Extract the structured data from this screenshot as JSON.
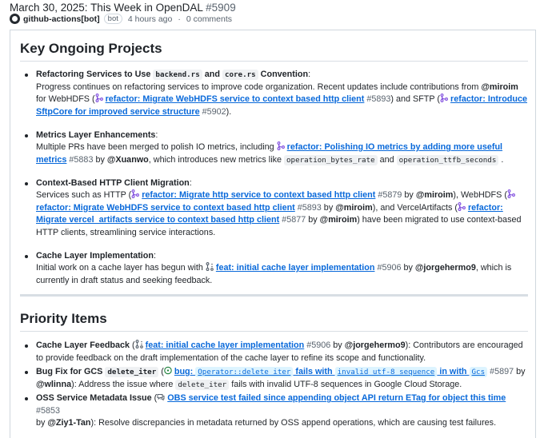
{
  "discussion": {
    "title": "March 30, 2025: This Week in OpenDAL",
    "number": "#5909",
    "author": "github-actions[bot]",
    "bot_badge": "bot",
    "time": "4 hours ago",
    "separator": "·",
    "comments": "0 comments"
  },
  "sections": {
    "key_title": "Key Ongoing Projects",
    "priority_title": "Priority Items"
  },
  "key": {
    "refactor": {
      "h1": "Refactoring Services to Use ",
      "code1": "backend.rs",
      "and": " and ",
      "code2": "core.rs",
      "h2": " Convention",
      "colon": ":",
      "t1": "Progress continues on refactoring services to improve code organization. Recent updates include contributions from ",
      "m1": "@miroim",
      "t2": " for WebHDFS (",
      "pr1": "refactor: Migrate WebHDFS service to context based http client",
      "n1": "#5893",
      "t3": ") and SFTP (",
      "pr2": "refactor: Introduce SftpCore for improved service structure",
      "n2": "#5902",
      "t4": ")."
    },
    "metrics": {
      "h": "Metrics Layer Enhancements",
      "colon": ":",
      "t1": "Multiple PRs have been merged to polish IO metrics, including ",
      "pr1": "refactor: Polishing IO metrics by adding more useful metrics",
      "n1": "#5883",
      "by": " by ",
      "m1": "@Xuanwo",
      "t2": ", which introduces new metrics like ",
      "c1": "operation_bytes_rate",
      "and": " and ",
      "c2": "operation_ttfb_seconds",
      "t3": " ."
    },
    "http": {
      "h": "Context-Based HTTP Client Migration",
      "colon": ":",
      "t1": "Services such as HTTP (",
      "pr1": "refactor: Migrate http service to context based http client",
      "n1": "#5879",
      "by1": " by ",
      "m1": "@miroim",
      "t2": "), WebHDFS (",
      "pr2": "refactor: Migrate WebHDFS service to context based http client",
      "n2": "#5893",
      "by2": " by ",
      "m2": "@miroim",
      "t3": "), and VercelArtifacts (",
      "pr3": "refactor: Migrate vercel_artifacts service to context based http client",
      "n3": "#5877",
      "by3": " by ",
      "m3": "@miroim",
      "t4": ") have been migrated to use context-based HTTP clients, streamlining service interactions."
    },
    "cache": {
      "h": "Cache Layer Implementation",
      "colon": ":",
      "t1": "Initial work on a cache layer has begun with ",
      "pr1": "feat: initial cache layer implementation",
      "n1": "#5906",
      "by": " by ",
      "m1": "@jorgehermo9",
      "t2": ", which is currently in draft status and seeking feedback."
    }
  },
  "priority": {
    "cache": {
      "h": "Cache Layer Feedback",
      "t1": " (",
      "pr1": "feat: initial cache layer implementation",
      "n1": "#5906",
      "by": " by ",
      "m1": "@jorgehermo9",
      "t2": "): Contributors are encouraged to provide feedback on the draft implementation of the cache layer to refine its scope and functionality."
    },
    "gcs": {
      "h": "Bug Fix for GCS ",
      "c": "delete_iter",
      "t1": " (",
      "prA": "bug: ",
      "prC1": "Operator::delete_iter",
      "prB": " fails with ",
      "prC2": "invalid utf-8 sequence",
      "prD": " in with ",
      "prC3": "Gcs",
      "n1": "#5897",
      "by": " by ",
      "m1": "@wlinna",
      "t2": "): Address the issue where ",
      "c2": "delete_iter",
      "t3": " fails with invalid UTF-8 sequences in Google Cloud Storage."
    },
    "oss": {
      "h": "OSS Service Metadata Issue",
      "t1": " (",
      "pr1": "OBS service test failed since appending object API return ETag for object this time",
      "n1": "#5853",
      "by": "by ",
      "m1": "@Ziy1-Tan",
      "t2": "): Resolve discrepancies in metadata returned by OSS append operations, which are causing test failures."
    }
  },
  "icons": {
    "pr": "pull-request-merged-icon",
    "draft": "draft-pull-request-icon",
    "issue": "open-issue-icon",
    "discussion": "discussion-icon"
  },
  "colors": {
    "link": "#0969da",
    "merged": "#8250df",
    "open": "#1a7f37",
    "draft": "#59636e"
  }
}
